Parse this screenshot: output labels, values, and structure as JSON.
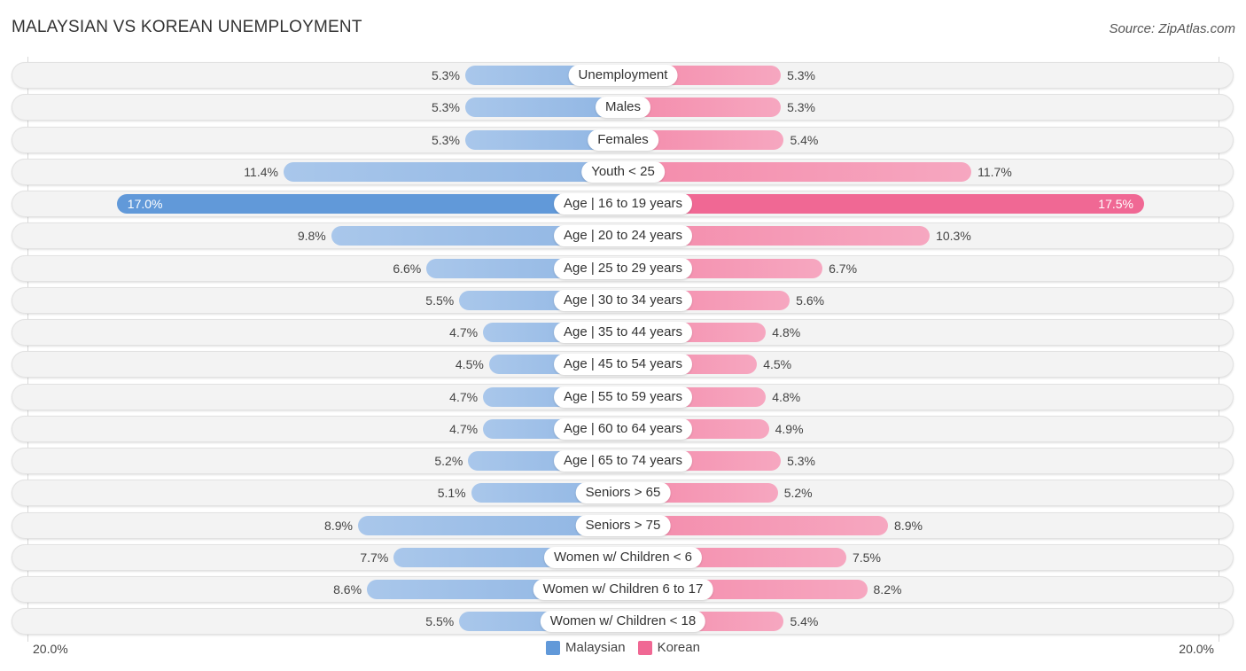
{
  "title": "MALAYSIAN VS KOREAN UNEMPLOYMENT",
  "source": "Source: ZipAtlas.com",
  "colors": {
    "malaysian": "#6199d9",
    "korean": "#f06894"
  },
  "axis": {
    "left_label": "20.0%",
    "right_label": "20.0%"
  },
  "legend": [
    {
      "name": "Malaysian",
      "color": "#6199d9"
    },
    {
      "name": "Korean",
      "color": "#f06894"
    }
  ],
  "chart_data": {
    "type": "bar",
    "orientation": "horizontal-diverging",
    "title": "MALAYSIAN VS KOREAN UNEMPLOYMENT",
    "xlim": [
      0,
      20
    ],
    "x_tick_labels": [
      "20.0%",
      "20.0%"
    ],
    "legend_position": "bottom-center",
    "value_suffix": "%",
    "highlight_index": 4,
    "categories": [
      "Unemployment",
      "Males",
      "Females",
      "Youth < 25",
      "Age | 16 to 19 years",
      "Age | 20 to 24 years",
      "Age | 25 to 29 years",
      "Age | 30 to 34 years",
      "Age | 35 to 44 years",
      "Age | 45 to 54 years",
      "Age | 55 to 59 years",
      "Age | 60 to 64 years",
      "Age | 65 to 74 years",
      "Seniors > 65",
      "Seniors > 75",
      "Women w/ Children < 6",
      "Women w/ Children 6 to 17",
      "Women w/ Children < 18"
    ],
    "series": [
      {
        "name": "Malaysian",
        "side": "left",
        "values": [
          5.3,
          5.3,
          5.3,
          11.4,
          17.0,
          9.8,
          6.6,
          5.5,
          4.7,
          4.5,
          4.7,
          4.7,
          5.2,
          5.1,
          8.9,
          7.7,
          8.6,
          5.5
        ]
      },
      {
        "name": "Korean",
        "side": "right",
        "values": [
          5.3,
          5.3,
          5.4,
          11.7,
          17.5,
          10.3,
          6.7,
          5.6,
          4.8,
          4.5,
          4.8,
          4.9,
          5.3,
          5.2,
          8.9,
          7.5,
          8.2,
          5.4
        ]
      }
    ]
  }
}
